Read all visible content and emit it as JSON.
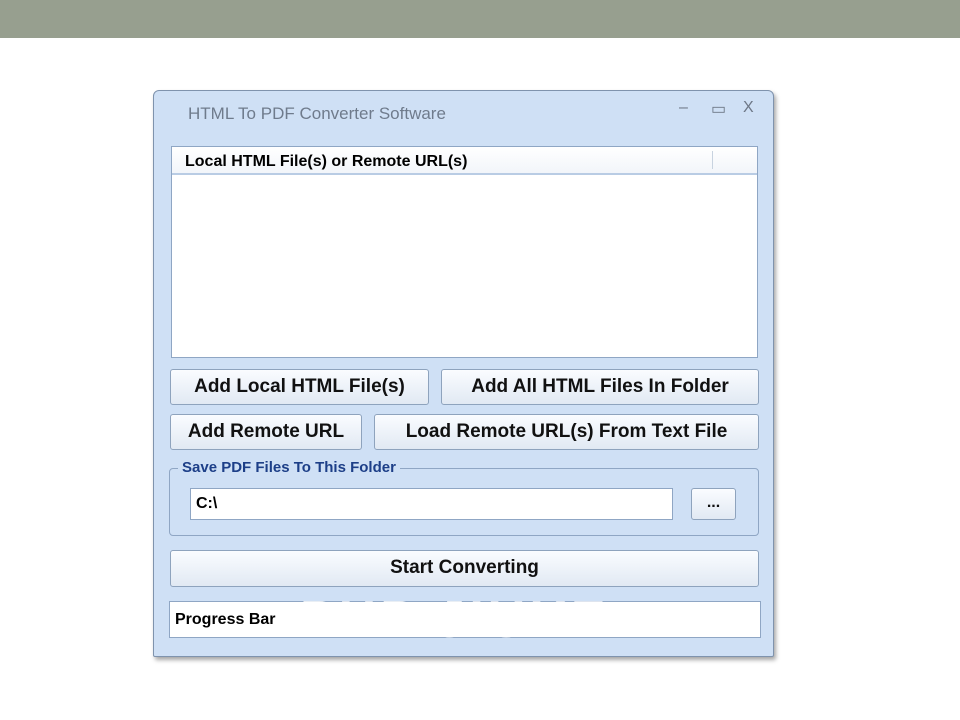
{
  "window": {
    "title": "HTML To PDF Converter Software",
    "minimize": "–",
    "maximize": "▭",
    "close": "X"
  },
  "list": {
    "column_header": "Local HTML File(s) or Remote URL(s)"
  },
  "buttons": {
    "add_local": "Add Local HTML File(s)",
    "add_folder": "Add All HTML Files In Folder",
    "add_remote": "Add Remote URL",
    "load_remote": "Load Remote URL(s) From Text File",
    "browse": "...",
    "start": "Start Converting"
  },
  "output": {
    "group_label": "Save PDF Files To This Folder",
    "folder_value": "C:\\"
  },
  "progress": {
    "label": "Progress Bar"
  },
  "watermark": "PHP JIUKE"
}
